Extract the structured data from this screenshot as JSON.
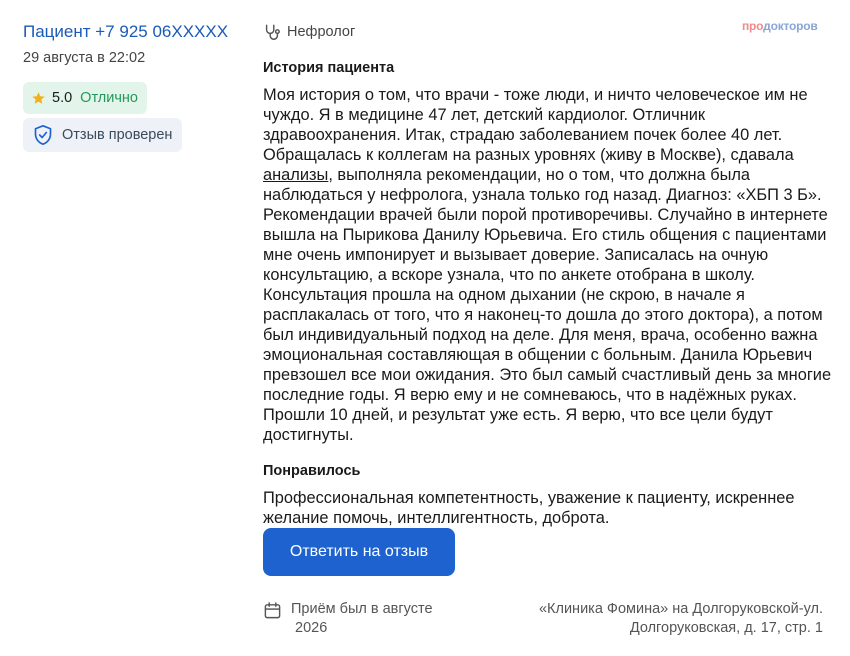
{
  "review": {
    "author": "Пациент +7 925 06XXXXX",
    "date": "29 августа в 22:02",
    "rating": {
      "score": "5.0",
      "grade": "Отлично"
    },
    "verified_label": "Отзыв проверен",
    "specialty": "Нефролог",
    "brand": {
      "part1": "про",
      "part2": "докторов"
    },
    "history_heading": "История пациента",
    "story": {
      "before_link": "Моя история о том, что врачи - тоже люди, и ничто человеческое им не чуждо. Я в медицине 47 лет, детский кардиолог. Отличник здравоохранения. Итак, страдаю заболеванием почек более 40 лет. Обращалась к коллегам на разных уровнях (живу в Москве), сдавала ",
      "link": "анализы",
      "after_link": ", выполняла рекомендации, но о том, что должна была наблюдаться у нефролога, узнала только год назад. Диагноз: «ХБП 3 Б». Рекомендации врачей были порой противоречивы. Случайно в интернете вышла на Пырикова Данилу Юрьевича. Его стиль общения с пациентами мне очень импонирует и вызывает доверие. Записалась на очную консультацию, а вскоре узнала, что по анкете отобрана в школу. Консультация прошла на одном дыхании (не скрою, в начале я расплакалась от того, что я наконец-то дошла до этого доктора), а потом был индивидуальный подход на деле. Для меня, врача, особенно важна эмоциональная составляющая в общении с больным. Данила Юрьевич превзошел все мои ожидания. Это был самый счастливый день за многие последние годы. Я верю ему и не сомневаюсь, что в надёжных руках. Прошли 10 дней, и результат уже есть. Я верю, что все цели будут достигнуты."
    },
    "liked_heading": "Понравилось",
    "liked_text": "Профессиональная компетентность, уважение к пациенту, искреннее желание помочь, интеллигентность, доброта.",
    "reply_button": "Ответить на отзыв",
    "visit": {
      "line1": "Приём был в августе",
      "line2": "2026"
    },
    "clinic": {
      "line1": "«Клиника Фомина» на Долгоруковской-ул.",
      "line2": "Долгоруковская, д. 17, стр. 1"
    }
  },
  "icons": {
    "star": "star-icon",
    "shield": "shield-check-icon",
    "specialty": "stethoscope-icon",
    "calendar": "calendar-icon"
  },
  "colors": {
    "link_blue": "#1a5ab8",
    "button_blue": "#1e62cf",
    "rating_bg": "#e3f5ea",
    "rating_green": "#23985a",
    "star": "#f2b01e",
    "verified_bg": "#eef2f8"
  }
}
